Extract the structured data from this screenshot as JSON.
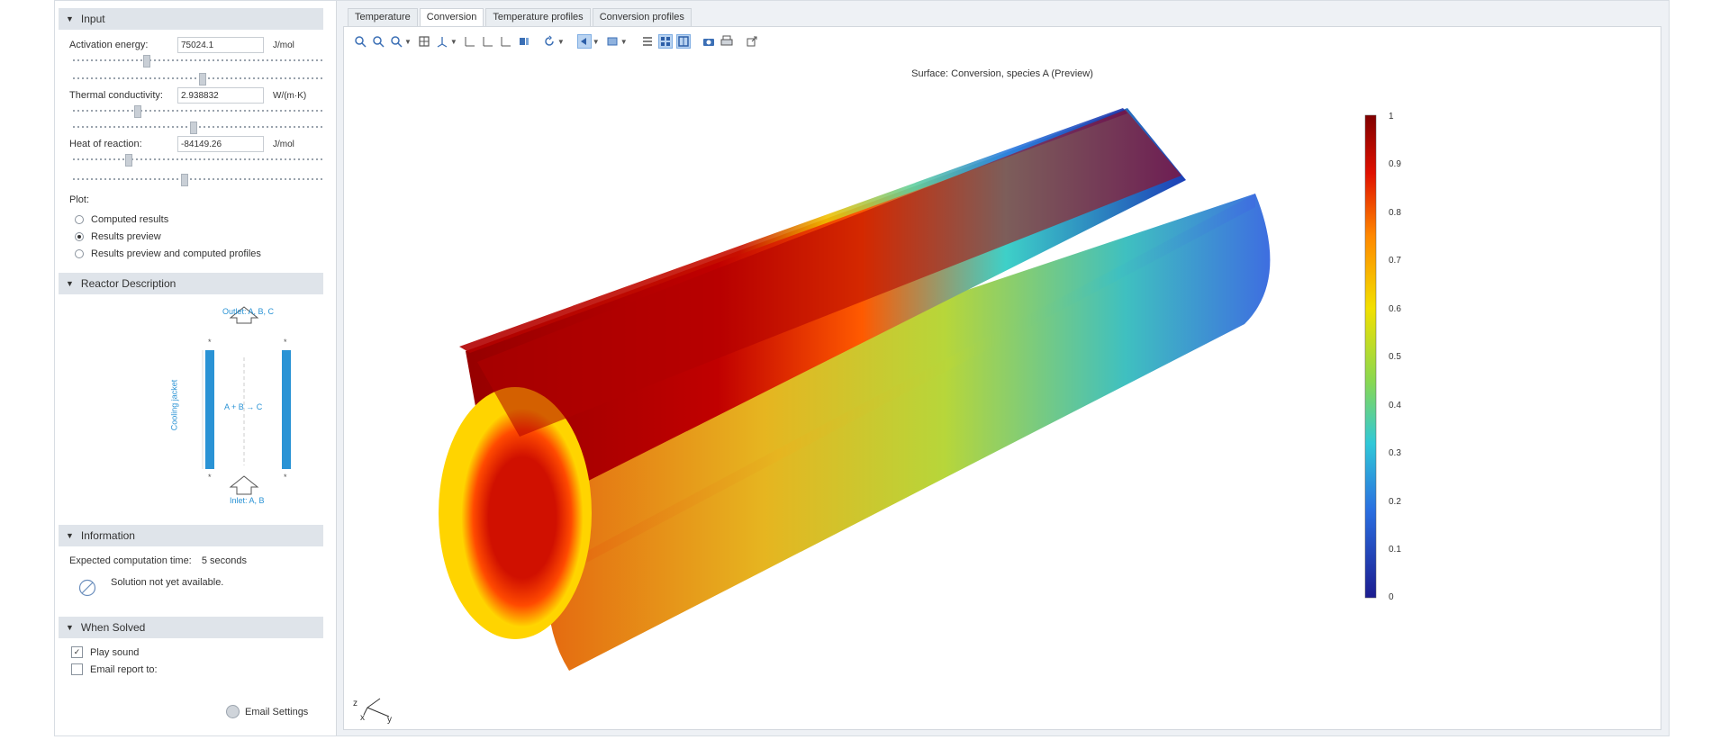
{
  "input": {
    "header": "Input",
    "activation_energy": {
      "label": "Activation energy:",
      "value": "75024.1",
      "unit": "J/mol"
    },
    "thermal_conductivity": {
      "label": "Thermal conductivity:",
      "value": "2.938832",
      "unit": "W/(m·K)"
    },
    "heat_of_reaction": {
      "label": "Heat of reaction:",
      "value": "-84149.26",
      "unit": "J/mol"
    },
    "plot_label": "Plot:",
    "plot_options": [
      {
        "label": "Computed results",
        "selected": false
      },
      {
        "label": "Results preview",
        "selected": true
      },
      {
        "label": "Results preview and computed profiles",
        "selected": false
      }
    ]
  },
  "reactor": {
    "header": "Reactor Description",
    "outlet": "Outlet: A, B, C",
    "inlet": "Inlet: A, B",
    "jacket": "Cooling jacket",
    "reaction": "A + B → C"
  },
  "information": {
    "header": "Information",
    "computation_label": "Expected computation time:",
    "computation_value": "5 seconds",
    "solution_status": "Solution not yet available."
  },
  "when_solved": {
    "header": "When Solved",
    "play_sound": {
      "label": "Play sound",
      "checked": true
    },
    "email_report": {
      "label": "Email report to:",
      "checked": false
    },
    "email_settings": "Email Settings"
  },
  "tabs": [
    {
      "label": "Temperature",
      "active": false
    },
    {
      "label": "Conversion",
      "active": true
    },
    {
      "label": "Temperature profiles",
      "active": false
    },
    {
      "label": "Conversion profiles",
      "active": false
    }
  ],
  "plot": {
    "title": "Surface: Conversion, species A (Preview)",
    "colorbar_ticks": [
      "1",
      "0.9",
      "0.8",
      "0.7",
      "0.6",
      "0.5",
      "0.4",
      "0.3",
      "0.2",
      "0.1",
      "0"
    ],
    "axes": {
      "x": "x",
      "y": "y",
      "z": "z"
    }
  },
  "colors": {
    "accent": "#2a93d5",
    "panel_header": "#dfe4ea"
  }
}
